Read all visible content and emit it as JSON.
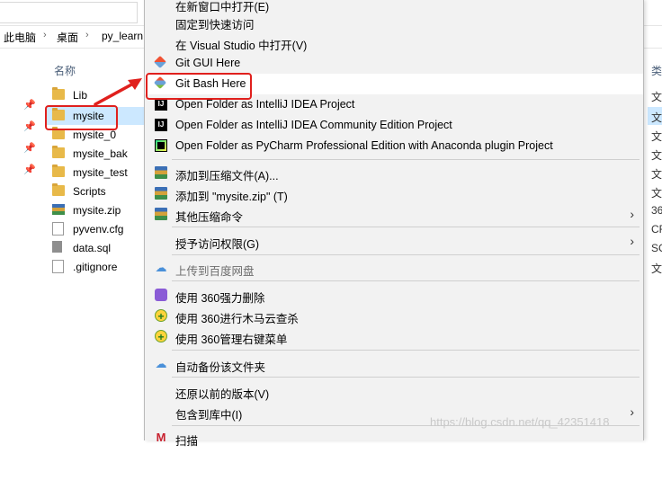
{
  "breadcrumb": [
    "此电脑",
    "桌面",
    "py_learn"
  ],
  "file_list": {
    "column_header": "名称",
    "items": [
      {
        "name": "Lib",
        "type": "folder"
      },
      {
        "name": "mysite",
        "type": "folder",
        "selected": true
      },
      {
        "name": "mysite_0",
        "type": "folder"
      },
      {
        "name": "mysite_bak",
        "type": "folder"
      },
      {
        "name": "mysite_test",
        "type": "folder"
      },
      {
        "name": "Scripts",
        "type": "folder"
      },
      {
        "name": "mysite.zip",
        "type": "zip"
      },
      {
        "name": "pyvenv.cfg",
        "type": "cfg"
      },
      {
        "name": "data.sql",
        "type": "sql"
      },
      {
        "name": ".gitignore",
        "type": "file"
      }
    ]
  },
  "type_column": {
    "header": "类",
    "values": [
      "文",
      "文",
      "文",
      "文",
      "文",
      "文",
      "36",
      "CF",
      "SC",
      "文"
    ]
  },
  "context_menu": {
    "items": [
      {
        "label": "在新窗口中打开(E)",
        "icon": "none"
      },
      {
        "label": "固定到快速访问",
        "icon": "none"
      },
      {
        "label": "在 Visual Studio 中打开(V)",
        "icon": "none"
      },
      {
        "label": "Git GUI Here",
        "icon": "git-gui-icon"
      },
      {
        "label": "Git Bash Here",
        "icon": "git-bash-icon"
      },
      {
        "label": "Open Folder as IntelliJ IDEA Project",
        "icon": "intellij-icon"
      },
      {
        "label": "Open Folder as IntelliJ IDEA Community Edition Project",
        "icon": "intellij-icon"
      },
      {
        "label": "Open Folder as PyCharm Professional Edition with Anaconda plugin Project",
        "icon": "pycharm-icon"
      },
      {
        "label": "添加到压缩文件(A)...",
        "icon": "winrar-icon"
      },
      {
        "label": "添加到 \"mysite.zip\" (T)",
        "icon": "winrar-icon"
      },
      {
        "label": "其他压缩命令",
        "icon": "winrar-icon",
        "submenu": true
      },
      {
        "label": "授予访问权限(G)",
        "icon": "none",
        "submenu": true
      },
      {
        "label": "上传到百度网盘",
        "icon": "baidu-cloud-icon",
        "disabled": true
      },
      {
        "label": "使用 360强力删除",
        "icon": "360-delete-icon"
      },
      {
        "label": "使用 360进行木马云查杀",
        "icon": "360-scan-icon"
      },
      {
        "label": "使用 360管理右键菜单",
        "icon": "360-menu-icon"
      },
      {
        "label": "自动备份该文件夹",
        "icon": "baidu-cloud-icon"
      },
      {
        "label": "还原以前的版本(V)",
        "icon": "none"
      },
      {
        "label": "包含到库中(I)",
        "icon": "none",
        "submenu": true
      },
      {
        "label": "扫描",
        "icon": "m-icon"
      }
    ]
  },
  "watermark": "https://blog.csdn.net/qq_42351418",
  "colors": {
    "highlight_red": "#e0201d",
    "selection_blue": "#cce8ff",
    "menu_bg": "#f2f2f2"
  }
}
